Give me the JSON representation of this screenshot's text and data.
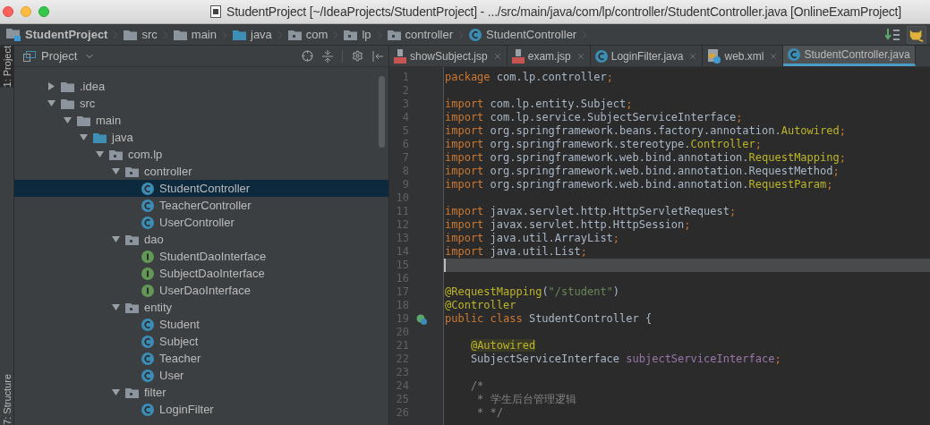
{
  "window": {
    "title": "StudentProject [~/IdeaProjects/StudentProject] - .../src/main/java/com/lp/controller/StudentController.java [OnlineExamProject]"
  },
  "breadcrumbs": [
    {
      "label": "StudentProject",
      "kind": "project"
    },
    {
      "label": "src",
      "kind": "folder"
    },
    {
      "label": "main",
      "kind": "folder"
    },
    {
      "label": "java",
      "kind": "source"
    },
    {
      "label": "com",
      "kind": "package"
    },
    {
      "label": "lp",
      "kind": "package"
    },
    {
      "label": "controller",
      "kind": "package"
    },
    {
      "label": "StudentController",
      "kind": "class"
    }
  ],
  "side_tabs": [
    {
      "label": "1: Project",
      "selected": true
    },
    {
      "label": "7: Structure",
      "selected": false
    }
  ],
  "project_panel": {
    "title": "Project",
    "tree": [
      {
        "label": ".idea",
        "kind": "folder",
        "expanded": false,
        "selected": false
      },
      {
        "label": "src",
        "kind": "folder",
        "expanded": true,
        "selected": false,
        "children": [
          {
            "label": "main",
            "kind": "folder",
            "expanded": true,
            "selected": false,
            "children": [
              {
                "label": "java",
                "kind": "source",
                "expanded": true,
                "selected": false,
                "children": [
                  {
                    "label": "com.lp",
                    "kind": "package",
                    "expanded": true,
                    "selected": false,
                    "children": [
                      {
                        "label": "controller",
                        "kind": "package",
                        "expanded": true,
                        "selected": false,
                        "children": [
                          {
                            "label": "StudentController",
                            "kind": "class",
                            "selected": true
                          },
                          {
                            "label": "TeacherController",
                            "kind": "class",
                            "selected": false
                          },
                          {
                            "label": "UserController",
                            "kind": "class",
                            "selected": false
                          }
                        ]
                      },
                      {
                        "label": "dao",
                        "kind": "package",
                        "expanded": true,
                        "selected": false,
                        "children": [
                          {
                            "label": "StudentDaoInterface",
                            "kind": "interface",
                            "selected": false
                          },
                          {
                            "label": "SubjectDaoInterface",
                            "kind": "interface",
                            "selected": false
                          },
                          {
                            "label": "UserDaoInterface",
                            "kind": "interface",
                            "selected": false
                          }
                        ]
                      },
                      {
                        "label": "entity",
                        "kind": "package",
                        "expanded": true,
                        "selected": false,
                        "children": [
                          {
                            "label": "Student",
                            "kind": "class",
                            "selected": false
                          },
                          {
                            "label": "Subject",
                            "kind": "class",
                            "selected": false
                          },
                          {
                            "label": "Teacher",
                            "kind": "class",
                            "selected": false
                          },
                          {
                            "label": "User",
                            "kind": "class",
                            "selected": false
                          }
                        ]
                      },
                      {
                        "label": "filter",
                        "kind": "package",
                        "expanded": true,
                        "selected": false,
                        "children": [
                          {
                            "label": "LoginFilter",
                            "kind": "class",
                            "selected": false
                          }
                        ]
                      }
                    ]
                  }
                ]
              }
            ]
          }
        ]
      }
    ]
  },
  "editor_tabs": [
    {
      "label": "showSubject.jsp",
      "kind": "jsp",
      "selected": false
    },
    {
      "label": "exam.jsp",
      "kind": "jsp",
      "selected": false
    },
    {
      "label": "LoginFilter.java",
      "kind": "class",
      "selected": false
    },
    {
      "label": "web.xml",
      "kind": "xml",
      "selected": false
    },
    {
      "label": "StudentController.java",
      "kind": "class",
      "selected": true
    }
  ],
  "code": [
    {
      "number": "1",
      "current": false,
      "tokens": [
        {
          "kind": "kw",
          "t": "package "
        },
        {
          "kind": "plain",
          "t": "com.lp.controller"
        },
        {
          "kind": "kw",
          "t": ";"
        }
      ]
    },
    {
      "number": "2",
      "current": false
    },
    {
      "number": "3",
      "current": false,
      "tokens": [
        {
          "kind": "kw",
          "t": "import "
        },
        {
          "kind": "plain",
          "t": "com.lp.entity.Subject"
        },
        {
          "kind": "kw",
          "t": ";"
        }
      ]
    },
    {
      "number": "4",
      "current": false,
      "tokens": [
        {
          "kind": "kw",
          "t": "import "
        },
        {
          "kind": "plain",
          "t": "com.lp.service.SubjectServiceInterface"
        },
        {
          "kind": "kw",
          "t": ";"
        }
      ]
    },
    {
      "number": "5",
      "current": false,
      "tokens": [
        {
          "kind": "kw",
          "t": "import "
        },
        {
          "kind": "plain",
          "t": "org.springframework.beans.factory.annotation."
        },
        {
          "kind": "ann",
          "t": "Autowired"
        },
        {
          "kind": "kw",
          "t": ";"
        }
      ]
    },
    {
      "number": "6",
      "current": false,
      "tokens": [
        {
          "kind": "kw",
          "t": "import "
        },
        {
          "kind": "plain",
          "t": "org.springframework.stereotype."
        },
        {
          "kind": "ann",
          "t": "Controller"
        },
        {
          "kind": "kw",
          "t": ";"
        }
      ]
    },
    {
      "number": "7",
      "current": false,
      "tokens": [
        {
          "kind": "kw",
          "t": "import "
        },
        {
          "kind": "plain",
          "t": "org.springframework.web.bind.annotation."
        },
        {
          "kind": "ann",
          "t": "RequestMapping"
        },
        {
          "kind": "kw",
          "t": ";"
        }
      ]
    },
    {
      "number": "8",
      "current": false,
      "tokens": [
        {
          "kind": "kw",
          "t": "import "
        },
        {
          "kind": "plain",
          "t": "org.springframework.web.bind.annotation.RequestMethod"
        },
        {
          "kind": "kw",
          "t": ";"
        }
      ]
    },
    {
      "number": "9",
      "current": false,
      "tokens": [
        {
          "kind": "kw",
          "t": "import "
        },
        {
          "kind": "plain",
          "t": "org.springframework.web.bind.annotation."
        },
        {
          "kind": "ann",
          "t": "RequestParam"
        },
        {
          "kind": "kw",
          "t": ";"
        }
      ]
    },
    {
      "number": "10",
      "current": false
    },
    {
      "number": "11",
      "current": false,
      "tokens": [
        {
          "kind": "kw",
          "t": "import "
        },
        {
          "kind": "plain",
          "t": "javax.servlet.http.HttpServletRequest"
        },
        {
          "kind": "kw",
          "t": ";"
        }
      ]
    },
    {
      "number": "12",
      "current": false,
      "tokens": [
        {
          "kind": "kw",
          "t": "import "
        },
        {
          "kind": "plain",
          "t": "javax.servlet.http.HttpSession"
        },
        {
          "kind": "kw",
          "t": ";"
        }
      ]
    },
    {
      "number": "13",
      "current": false,
      "tokens": [
        {
          "kind": "kw",
          "t": "import "
        },
        {
          "kind": "plain",
          "t": "java.util.ArrayList"
        },
        {
          "kind": "kw",
          "t": ";"
        }
      ]
    },
    {
      "number": "14",
      "current": false,
      "tokens": [
        {
          "kind": "kw",
          "t": "import "
        },
        {
          "kind": "plain",
          "t": "java.util.List"
        },
        {
          "kind": "kw",
          "t": ";"
        }
      ]
    },
    {
      "number": "15",
      "current": true
    },
    {
      "number": "16",
      "current": false
    },
    {
      "number": "17",
      "current": false,
      "tokens": [
        {
          "kind": "ann",
          "t": "@RequestMapping"
        },
        {
          "kind": "plain",
          "t": "("
        },
        {
          "kind": "str",
          "t": "\"/student\""
        },
        {
          "kind": "plain",
          "t": ")"
        }
      ]
    },
    {
      "number": "18",
      "current": false,
      "tokens": [
        {
          "kind": "ann",
          "t": "@Controller"
        }
      ]
    },
    {
      "number": "19",
      "current": false,
      "kind": "implemented",
      "tokens": [
        {
          "kind": "kw",
          "t": "public class "
        },
        {
          "kind": "plain",
          "t": "StudentController {"
        }
      ]
    },
    {
      "number": "20",
      "current": false
    },
    {
      "number": "21",
      "current": false,
      "tokens": [
        {
          "kind": "annhl",
          "t": "    @Autowired"
        }
      ]
    },
    {
      "number": "22",
      "current": false,
      "tokens": [
        {
          "kind": "plain",
          "t": "    SubjectServiceInterface "
        },
        {
          "kind": "field",
          "t": "subjectServiceInterface"
        },
        {
          "kind": "kw",
          "t": ";"
        }
      ]
    },
    {
      "number": "23",
      "current": false
    },
    {
      "number": "24",
      "current": false,
      "tokens": [
        {
          "kind": "comment",
          "t": "    /*"
        }
      ]
    },
    {
      "number": "25",
      "current": false,
      "tokens": [
        {
          "kind": "comment",
          "t": "     * 学生后台管理逻辑"
        }
      ]
    },
    {
      "number": "26",
      "current": false,
      "tokens": [
        {
          "kind": "comment",
          "t": "     * */"
        }
      ]
    }
  ]
}
